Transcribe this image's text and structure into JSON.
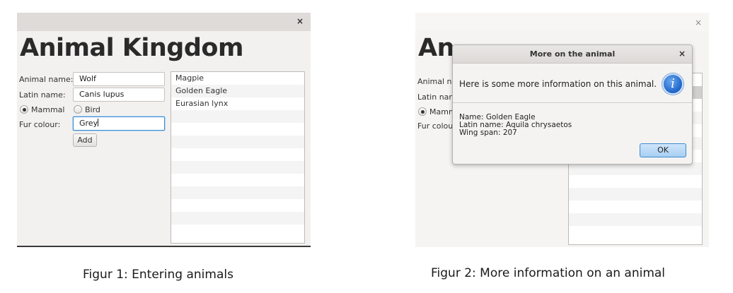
{
  "figure1": {
    "app_title": "Animal Kingdom",
    "form": {
      "animal_name_label": "Animal name:",
      "animal_name_value": "Wolf",
      "latin_name_label": "Latin name:",
      "latin_name_value": "Canis lupus",
      "radio_mammal": "Mammal",
      "radio_bird": "Bird",
      "fur_colour_label": "Fur colour:",
      "fur_colour_value": "Grey",
      "add_button": "Add"
    },
    "list_items": [
      "Magpie",
      "Golden Eagle",
      "Eurasian lynx"
    ],
    "close_glyph": "×"
  },
  "figure2": {
    "partial_title": "An",
    "labels": {
      "animal_name": "Animal na",
      "latin_name": "Latin nam",
      "mammal": "Mamm",
      "fur_colour": "Fur colour"
    },
    "close_glyph": "×",
    "dialog": {
      "title": "More on the animal",
      "close_glyph": "×",
      "header_text": "Here is some more information on this animal.",
      "icon_glyph": "i",
      "content": [
        "Name: Golden Eagle",
        "Latin name: Aquila chrysaetos",
        "Wing span: 207"
      ],
      "ok_button": "OK"
    }
  },
  "captions": {
    "fig1": "Figur 1: Entering animals",
    "fig2": "Figur 2: More information on an animal"
  },
  "colors": {
    "focus_border": "#3d8fd1",
    "info_icon": "#1d63c9",
    "ok_button": "#a7cff2"
  }
}
